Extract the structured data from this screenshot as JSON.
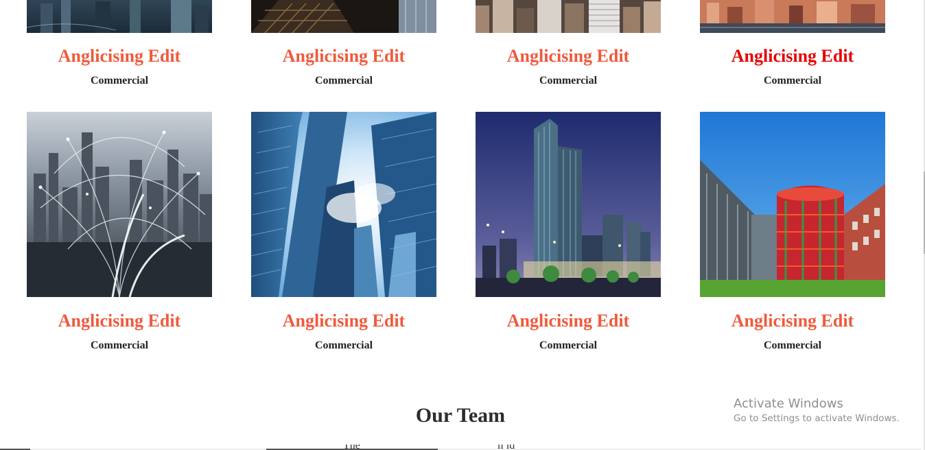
{
  "row1": [
    {
      "title": "Anglicising Edit",
      "subtitle": "Commercial",
      "image": "city-night-aerial"
    },
    {
      "title": "Anglicising Edit",
      "subtitle": "Commercial",
      "image": "glass-dome-skyscraper"
    },
    {
      "title": "Anglicising Edit",
      "subtitle": "Commercial",
      "image": "manhattan-skyline"
    },
    {
      "title": "Anglicising Edit",
      "subtitle": "Commercial",
      "image": "waterfront-skyline-dusk",
      "active": true
    }
  ],
  "row2": [
    {
      "title": "Anglicising Edit",
      "subtitle": "Commercial",
      "image": "connected-city-network"
    },
    {
      "title": "Anglicising Edit",
      "subtitle": "Commercial",
      "image": "skyscrapers-looking-up"
    },
    {
      "title": "Anglicising Edit",
      "subtitle": "Commercial",
      "image": "office-tower-night"
    },
    {
      "title": "Anglicising Edit",
      "subtitle": "Commercial",
      "image": "red-cylinder-building"
    }
  ],
  "section": {
    "title": "Our Team"
  },
  "windows_watermark": {
    "line1": "Activate Windows",
    "line2": "Go to Settings to activate Windows."
  },
  "colors": {
    "title": "#ef5a3c",
    "title_active": "#e60000",
    "subtitle": "#222222",
    "heading": "#2c2c2c"
  }
}
